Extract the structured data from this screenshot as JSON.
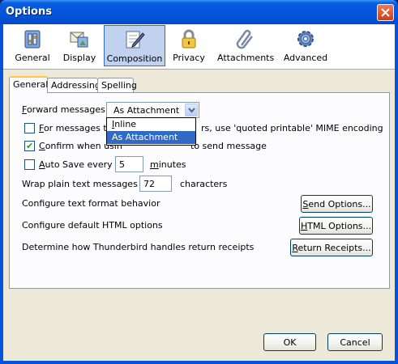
{
  "window": {
    "title": "Options"
  },
  "toolbar": {
    "items": [
      {
        "label": "General"
      },
      {
        "label": "Display"
      },
      {
        "label": "Composition"
      },
      {
        "label": "Privacy"
      },
      {
        "label": "Attachments"
      },
      {
        "label": "Advanced"
      }
    ]
  },
  "tabs": [
    {
      "label": "General"
    },
    {
      "label": "Addressing"
    },
    {
      "label": "Spelling"
    }
  ],
  "general": {
    "forward_label_a": "F",
    "forward_label_b": "orward messages:",
    "forward_value": "As Attachment",
    "forward_options": [
      {
        "label": "Inline"
      },
      {
        "label": "As Attachment"
      }
    ],
    "qp_a": "F",
    "qp_b": "or messages tha",
    "qp_c": "rs, use 'quoted printable' MIME encoding",
    "confirm_a": "C",
    "confirm_b": "onfirm when usin",
    "confirm_c": "to send message",
    "autosave_a": "A",
    "autosave_b": "uto Save every",
    "autosave_value": "5",
    "autosave_unit_a": "m",
    "autosave_unit_b": "inutes",
    "wrap_label": "Wrap plain text messages at",
    "wrap_value": "72",
    "wrap_unit": "characters",
    "text_format_label": "Configure text format behavior",
    "send_options_a": "S",
    "send_options_b": "end Options...",
    "html_label": "Configure default HTML options",
    "html_options_a": "H",
    "html_options_b": "TML Options...",
    "receipts_label": "Determine how Thunderbird handles return receipts",
    "receipts_a": "R",
    "receipts_b": "eturn Receipts..."
  },
  "footer": {
    "ok": "OK",
    "cancel": "Cancel"
  },
  "state": {
    "qp_checked": false,
    "confirm_checked": true,
    "autosave_checked": false
  }
}
